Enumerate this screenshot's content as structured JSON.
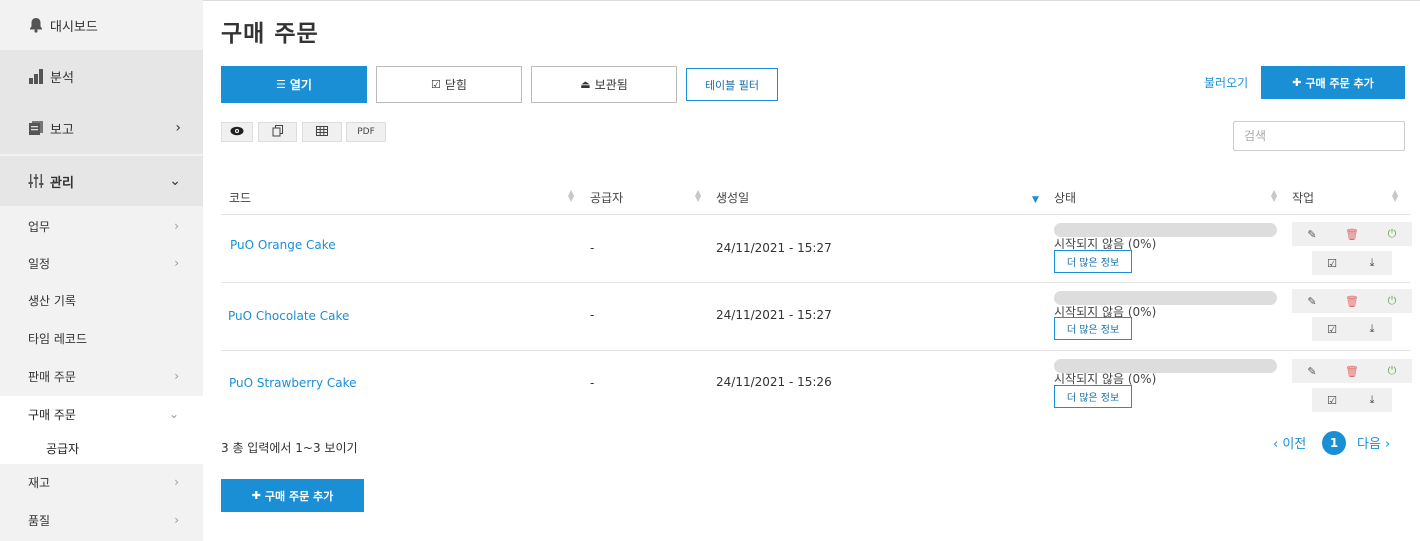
{
  "sidebar": {
    "top": [
      {
        "label": "대시보드",
        "icon": "bell-icon"
      },
      {
        "label": "분석",
        "icon": "bar-chart-icon"
      },
      {
        "label": "보고",
        "icon": "report-icon",
        "chevron": "›"
      },
      {
        "label": "관리",
        "icon": "sliders-icon",
        "chevron": "⌄"
      }
    ],
    "sub": [
      {
        "label": "업무",
        "chevron": "›"
      },
      {
        "label": "일정",
        "chevron": "›"
      },
      {
        "label": "생산 기록"
      },
      {
        "label": "타임 레코드"
      },
      {
        "label": "판매 주문",
        "chevron": "›"
      },
      {
        "label": "구매 주문",
        "chevron": "⌄"
      },
      {
        "label": "공급자"
      },
      {
        "label": "재고",
        "chevron": "›"
      },
      {
        "label": "품질",
        "chevron": "›"
      }
    ]
  },
  "page": {
    "title": "구매 주문"
  },
  "tabs": [
    {
      "label": "열기",
      "icon": "list-icon"
    },
    {
      "label": "닫힘",
      "icon": "check-square-icon"
    },
    {
      "label": "보관됨",
      "icon": "inbox-icon"
    }
  ],
  "toolbar": {
    "filter_label": "테이블 필터",
    "import_label": "불러오기",
    "add_label": "구매 주문 추가",
    "export_pdf": "PDF",
    "search_placeholder": "검색"
  },
  "table": {
    "headers": [
      "코드",
      "공급자",
      "생성일",
      "상태",
      "작업"
    ],
    "rows": [
      {
        "code": "PuO Orange Cake",
        "supplier": "-",
        "created": "24/11/2021 - 15:27",
        "status": "시작되지 않음 (0%)",
        "progress": 0,
        "more": "더 많은 정보"
      },
      {
        "code": "PuO Chocolate Cake",
        "supplier": "-",
        "created": "24/11/2021 - 15:27",
        "status": "시작되지 않음 (0%)",
        "progress": 0,
        "more": "더 많은 정보"
      },
      {
        "code": "PuO Strawberry Cake",
        "supplier": "-",
        "created": "24/11/2021 - 15:26",
        "status": "시작되지 않음 (0%)",
        "progress": 0,
        "more": "더 많은 정보"
      }
    ]
  },
  "footer": {
    "info": "3 총 입력에서 1~3 보이기",
    "prev": "‹ 이전",
    "current_page": "1",
    "next": "다음 ›",
    "add_label": "구매 주문 추가"
  },
  "colors": {
    "accent": "#1a8fd6",
    "sidebar_bg": "#f2f2f2",
    "delete": "#e06666",
    "power": "#6aa84f"
  }
}
